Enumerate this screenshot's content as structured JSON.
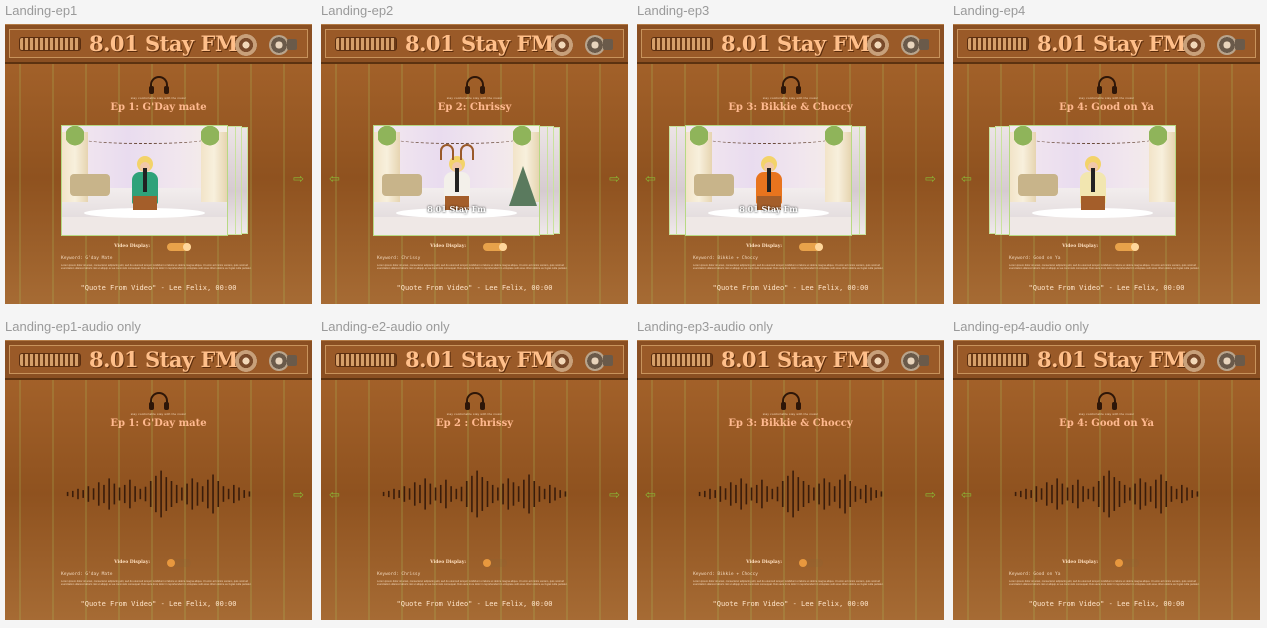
{
  "station_name": "8.01 Stay FM",
  "tagline": "stay comfortable stay with the music",
  "toggle_label": "Video Display:",
  "quote": "\"Quote From Video\" - Lee Felix, 00:00",
  "description": "Lorem ipsum dolor sit amet, consectetur adipiscing elit, sed do eiusmod tempor incididunt ut labore et dolore magna aliqua. Ut enim ad minim veniam, quis nostrud exercitation ullamco laboris nisi ut aliquip ex ea commodo consequat. Duis aute irure dolor in reprehenderit in voluptate velit esse cillum dolore eu fugiat nulla pariatur.",
  "arrows": {
    "next": "⇨",
    "prev": "⇦"
  },
  "colors": {
    "accent": "#e8a24a",
    "title": "#ffb98f",
    "arrow": "#8ab535"
  },
  "frames": [
    {
      "label": "Landing-ep1",
      "title": "Ep 1: G'Day mate",
      "keyword": "Keyword: G'day Mate",
      "mode": "video",
      "video_display": "on",
      "prev": false,
      "next": true,
      "outfit": "#2fa27a",
      "variant": "ep1"
    },
    {
      "label": "Landing-ep2",
      "title": "Ep 2: Chrissy",
      "keyword": "Keyword: Chrissy",
      "mode": "video",
      "video_display": "on",
      "prev": true,
      "next": true,
      "outfit": "#f3f0ea",
      "variant": "ep2",
      "caption": "8.01 Stay Fm"
    },
    {
      "label": "Landing-ep3",
      "title": "Ep 3: Bikkie & Choccy",
      "keyword": "Keyword: Bikkie + Choccy",
      "mode": "video",
      "video_display": "on",
      "prev": true,
      "next": true,
      "outfit": "#e8741e",
      "variant": "ep3",
      "caption": "8.01 Stay Fm"
    },
    {
      "label": "Landing-ep4",
      "title": "Ep 4: Good on Ya",
      "keyword": "Keyword: Good on Ya",
      "mode": "video",
      "video_display": "on",
      "prev": true,
      "next": false,
      "outfit": "#f2e6b0",
      "variant": "ep4"
    },
    {
      "label": "Landing-ep1-audio only",
      "title": "Ep 1: G'Day mate",
      "keyword": "Keyword: G'day Mate",
      "mode": "audio",
      "video_display": "off",
      "prev": false,
      "next": true
    },
    {
      "label": "Landing-e2-audio only",
      "title": "Ep 2 : Chrissy",
      "keyword": "Keyword: Chrissy",
      "mode": "audio",
      "video_display": "off",
      "prev": true,
      "next": true
    },
    {
      "label": "Landing-ep3-audio only",
      "title": "Ep 3: Bikkie & Choccy",
      "keyword": "Keyword: Bikkie + Choccy",
      "mode": "audio",
      "video_display": "off",
      "prev": true,
      "next": true
    },
    {
      "label": "Landing-ep4-audio only",
      "title": "Ep 4: Good on Ya",
      "keyword": "Keyword: Good on Ya",
      "mode": "audio",
      "video_display": "off",
      "prev": true,
      "next": false
    }
  ],
  "waveform_levels": [
    0.08,
    0.12,
    0.2,
    0.15,
    0.3,
    0.22,
    0.45,
    0.35,
    0.6,
    0.4,
    0.25,
    0.35,
    0.55,
    0.3,
    0.2,
    0.28,
    0.5,
    0.7,
    0.9,
    0.65,
    0.5,
    0.35,
    0.25,
    0.4,
    0.6,
    0.45,
    0.3,
    0.55,
    0.75,
    0.5,
    0.3,
    0.2,
    0.35,
    0.25,
    0.15,
    0.1
  ]
}
